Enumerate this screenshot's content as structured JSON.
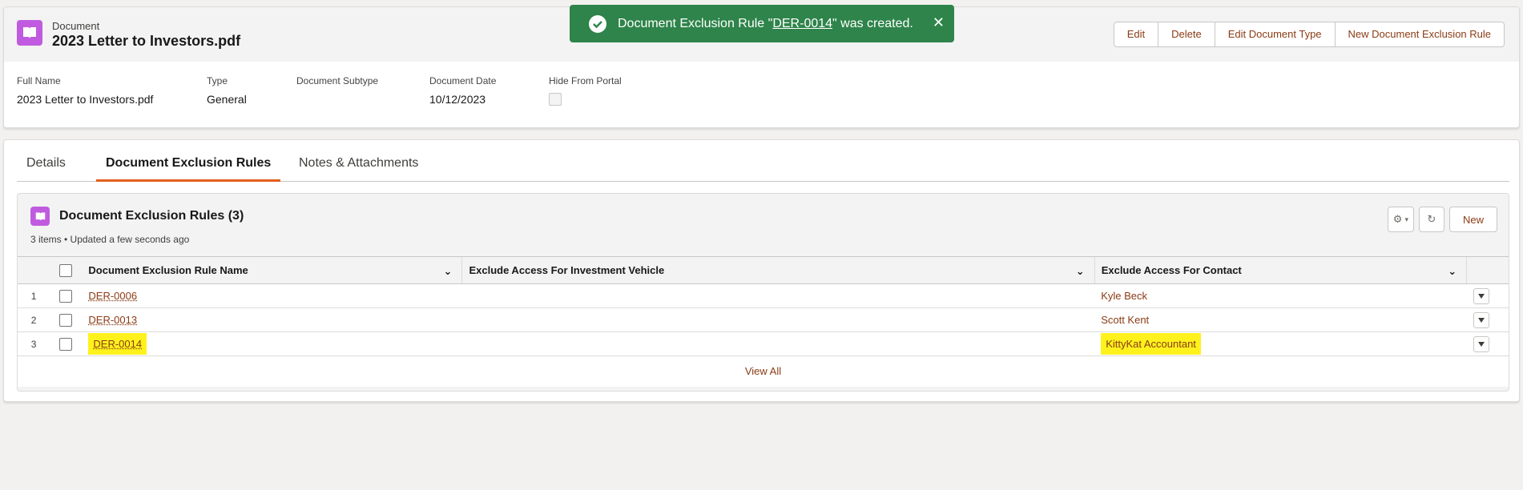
{
  "record": {
    "object_label": "Document",
    "title": "2023 Letter to Investors.pdf"
  },
  "actions": [
    "Edit",
    "Delete",
    "Edit Document Type",
    "New Document Exclusion Rule"
  ],
  "fields": {
    "full_name_label": "Full Name",
    "full_name_value": "2023 Letter to Investors.pdf",
    "type_label": "Type",
    "type_value": "General",
    "subtype_label": "Document Subtype",
    "subtype_value": "",
    "date_label": "Document Date",
    "date_value": "10/12/2023",
    "portal_label": "Hide From Portal"
  },
  "toast": {
    "prefix": "Document Exclusion Rule \"",
    "link": "DER-0014",
    "suffix": "\" was created.",
    "color": "#2e844a"
  },
  "tabs": [
    "Details",
    "Document Exclusion Rules",
    "Notes & Attachments"
  ],
  "related": {
    "title": "Document Exclusion Rules (3)",
    "meta": "3 items • Updated a few seconds ago",
    "new_label": "New",
    "columns": [
      "Document Exclusion Rule Name",
      "Exclude Access For Investment Vehicle",
      "Exclude Access For Contact"
    ],
    "rows": [
      {
        "num": "1",
        "name": "DER-0006",
        "vehicle": "",
        "contact": "Kyle Beck"
      },
      {
        "num": "2",
        "name": "DER-0013",
        "vehicle": "",
        "contact": "Scott Kent"
      },
      {
        "num": "3",
        "name": "DER-0014",
        "vehicle": "",
        "contact": "KittyKat Accountant"
      }
    ],
    "view_all": "View All"
  },
  "colors": {
    "accent": "#e35f1c",
    "link": "#8a3b14",
    "object_icon": "#c05be0",
    "highlight": "#fff21c"
  }
}
